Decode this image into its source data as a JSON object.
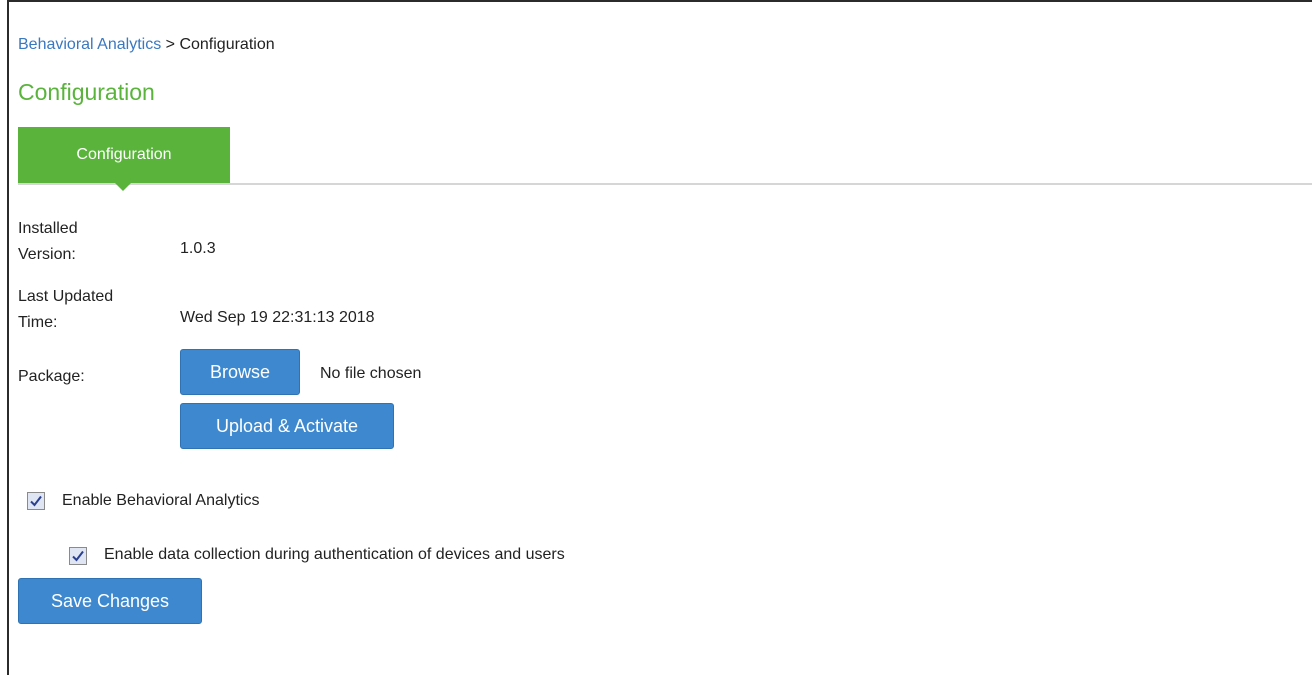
{
  "breadcrumb": {
    "parent": "Behavioral Analytics",
    "separator": ">",
    "current": "Configuration"
  },
  "page_title": "Configuration",
  "tabs": [
    {
      "label": "Configuration",
      "active": true
    }
  ],
  "form": {
    "installed_version_label_line1": "Installed",
    "installed_version_label_line2": "Version:",
    "installed_version_value": "1.0.3",
    "last_updated_label_line1": "Last Updated",
    "last_updated_label_line2": "Time:",
    "last_updated_value": "Wed Sep 19 22:31:13 2018",
    "package_label": "Package:",
    "browse_label": "Browse",
    "file_status": "No file chosen",
    "upload_label": "Upload & Activate"
  },
  "options": {
    "enable_ba_label": "Enable Behavioral Analytics",
    "enable_ba_checked": true,
    "enable_data_collection_label": "Enable data collection during authentication of devices and users",
    "enable_data_collection_checked": true
  },
  "save_label": "Save Changes",
  "colors": {
    "accent_green": "#5ab43c",
    "button_blue": "#3d88cf",
    "link_blue": "#3a78c0"
  },
  "icons": {
    "checkbox_checked": "checkmark-icon"
  }
}
